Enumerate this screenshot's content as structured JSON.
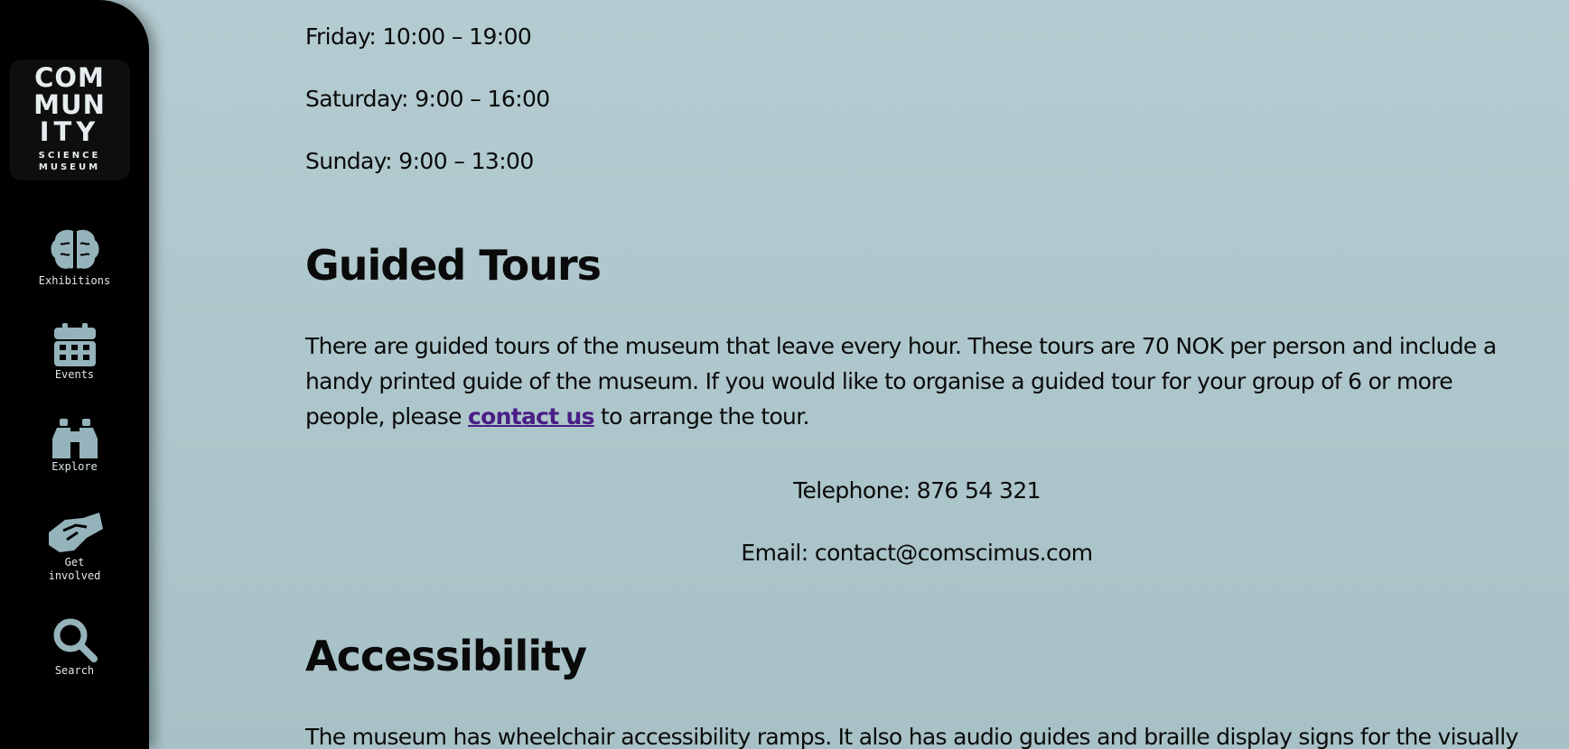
{
  "sidebar": {
    "logo": {
      "lines": [
        "COM",
        "MUN",
        "ITY"
      ],
      "sub1": "SCIENCE",
      "sub2": "MUSEUM"
    },
    "items": [
      {
        "label": "Exhibitions",
        "icon": "brain-icon"
      },
      {
        "label": "Events",
        "icon": "calendar-icon"
      },
      {
        "label": "Explore",
        "icon": "binoculars-icon"
      },
      {
        "label": "Get\ninvolved",
        "icon": "handshake-icon"
      },
      {
        "label": "Search",
        "icon": "search-icon"
      }
    ],
    "icon_color": "#95b3ba"
  },
  "hours": {
    "friday": "Friday: 10:00 – 19:00",
    "saturday": "Saturday: 9:00 – 16:00",
    "sunday": "Sunday: 9:00 – 13:00"
  },
  "guided_tours": {
    "heading": "Guided Tours",
    "text_before_link": "There are guided tours of the museum that leave every hour. These tours are 70 NOK per person and include a handy printed guide of the museum. If you would like to organise a guided tour for your group of 6 or more people, please ",
    "link_text": "contact us",
    "text_after_link": " to arrange the tour.",
    "telephone": "Telephone: 876 54 321",
    "email": "Email: contact@comscimus.com"
  },
  "accessibility": {
    "heading": "Accessibility",
    "text": "The museum has wheelchair accessibility ramps. It also has audio guides and braille display signs for the visually"
  },
  "colors": {
    "background": "#b0c9ce",
    "sidebar": "#000000",
    "link": "#4b1e87"
  }
}
